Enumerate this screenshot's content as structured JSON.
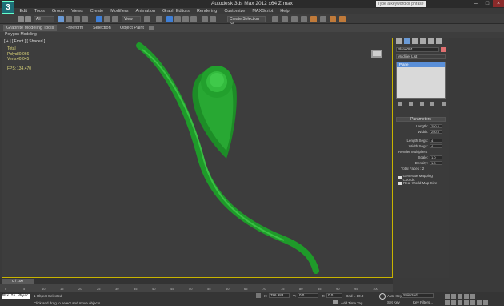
{
  "window": {
    "title": "Autodesk 3ds Max 2012 x64    Z.max",
    "search_placeholder": "Type a keyword or phrase",
    "app_icon": "3ds-max-logo"
  },
  "menu": [
    "Edit",
    "Tools",
    "Group",
    "Views",
    "Create",
    "Modifiers",
    "Animation",
    "Graph Editors",
    "Rendering",
    "Customize",
    "MAXScript",
    "Help"
  ],
  "toolbar": {
    "filter": "All",
    "ref_coord": "View",
    "selection_set": "Create Selection Se"
  },
  "ribbon": {
    "tabs": [
      "Graphite Modeling Tools",
      "Freeform",
      "Selection",
      "Object Paint"
    ],
    "sub_label": "Polygon Modeling"
  },
  "viewport": {
    "label": "[ + ] [ Front ] [ Shaded ]",
    "stats": {
      "total_label": "Total",
      "polys_label": "Polys:",
      "polys_value": "80,066",
      "verts_label": "Verts:",
      "verts_value": "40,045",
      "fps_label": "FPS:",
      "fps_value": "134.470"
    },
    "stem_color": "#1f9a2a",
    "leaf_color": "#22a82e"
  },
  "command_panel": {
    "object_name": "Plane001",
    "modifier_list": "Modifier List",
    "stack_item": "Plane",
    "parameters_title": "Parameters",
    "length_label": "Length:",
    "length_value": "250.0",
    "width_label": "Width:",
    "width_value": "250.0",
    "length_segs_label": "Length Segs:",
    "length_segs_value": "4",
    "width_segs_label": "Width Segs:",
    "width_segs_value": "4",
    "render_mult_label": "Render Multipliers",
    "scale_label": "Scale:",
    "scale_value": "1.0",
    "density_label": "Density:",
    "density_value": "1.0",
    "total_faces": "Total Faces : 2",
    "gen_mapping": "Generate Mapping Coords.",
    "real_world": "Real-World Map Size"
  },
  "timeline": {
    "frame_display": "0 / 100",
    "ticks": [
      "0",
      "5",
      "10",
      "15",
      "20",
      "25",
      "30",
      "35",
      "40",
      "45",
      "50",
      "55",
      "60",
      "65",
      "70",
      "75",
      "80",
      "85",
      "90",
      "95",
      "100"
    ]
  },
  "status": {
    "maxscript": "Max to Physc",
    "selected": "1 Object Selected",
    "hint": "Click and drag to select and move objects",
    "x_label": "X:",
    "x_value": "786.983",
    "y_label": "Y:",
    "y_value": "0.0",
    "z_label": "Z:",
    "z_value": "0.0",
    "grid": "Grid = 10.0",
    "add_time_tag": "Add Time Tag",
    "auto_key": "Auto Key",
    "selected_dropdown": "Selected",
    "set_key": "Set Key",
    "key_filters": "Key Filters..."
  }
}
